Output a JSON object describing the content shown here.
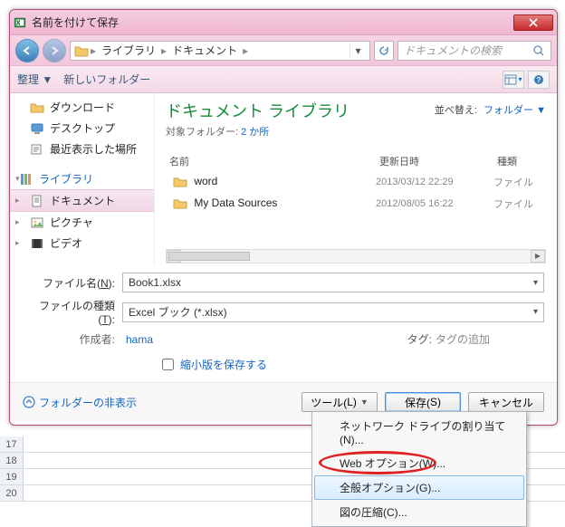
{
  "window": {
    "title": "名前を付けて保存"
  },
  "nav": {
    "back_label": "←",
    "fwd_label": "→",
    "path_seg1": "ライブラリ",
    "path_seg2": "ドキュメント",
    "search_placeholder": "ドキュメントの検索"
  },
  "toolbar": {
    "organize": "整理 ▼",
    "newfolder": "新しいフォルダー"
  },
  "sidebar": {
    "items": [
      {
        "label": "ダウンロード"
      },
      {
        "label": "デスクトップ"
      },
      {
        "label": "最近表示した場所"
      },
      {
        "label": "ライブラリ"
      },
      {
        "label": "ドキュメント"
      },
      {
        "label": "ピクチャ"
      },
      {
        "label": "ビデオ"
      }
    ]
  },
  "library": {
    "title": "ドキュメント ライブラリ",
    "sub_label": "対象フォルダー:",
    "sub_link": "2 か所",
    "sort_label": "並べ替え:",
    "sort_value": "フォルダー ▼"
  },
  "columns": {
    "name": "名前",
    "date": "更新日時",
    "type": "種類"
  },
  "rows": [
    {
      "name": "word",
      "date": "2013/03/12 22:29",
      "type": "ファイル"
    },
    {
      "name": "My Data Sources",
      "date": "2012/08/05 16:22",
      "type": "ファイル"
    }
  ],
  "form": {
    "filename_label_pre": "ファイル名(",
    "filename_label_u": "N",
    "filename_label_post": "):",
    "filename_value": "Book1.xlsx",
    "filetype_label_pre": "ファイルの種類(",
    "filetype_label_u": "T",
    "filetype_label_post": "):",
    "filetype_value": "Excel ブック (*.xlsx)",
    "author_label": "作成者:",
    "author_value": "hama",
    "tag_label": "タグ:",
    "tag_value": "タグの追加",
    "thumb_label": "縮小版を保存する"
  },
  "footer": {
    "hide_label": "フォルダーの非表示",
    "tools_pre": "ツール(",
    "tools_u": "L",
    "tools_post": ")",
    "save_pre": "保存(",
    "save_u": "S",
    "save_post": ")",
    "cancel": "キャンセル"
  },
  "menu": {
    "items": [
      {
        "label": "ネットワーク ドライブの割り当て(N)..."
      },
      {
        "label": "Web オプション(W)..."
      },
      {
        "label": "全般オプション(G)..."
      },
      {
        "label": "図の圧縮(C)..."
      }
    ],
    "highlight_index": 2
  },
  "sheet": {
    "rows": [
      "17",
      "18",
      "19",
      "20"
    ]
  },
  "colors": {
    "accent_pink": "#f0b7d1",
    "link_blue": "#1565c0",
    "title_green": "#178a3a",
    "annot_red": "#d22"
  }
}
